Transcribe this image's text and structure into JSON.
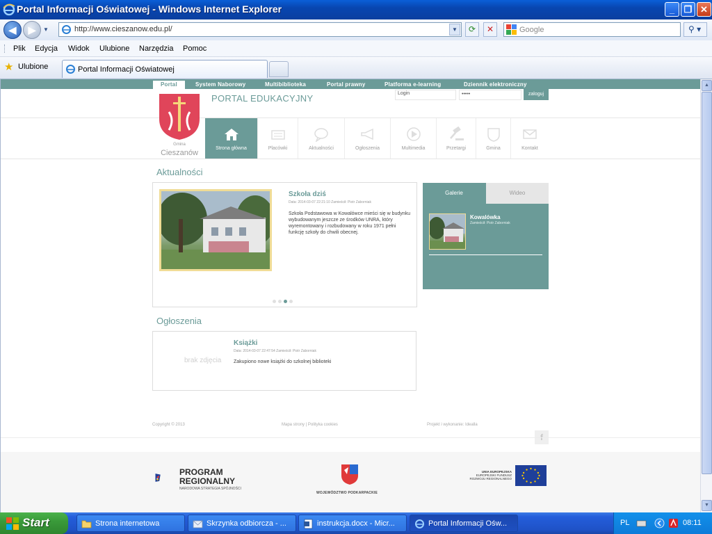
{
  "window": {
    "title": "Portal Informacji Oświatowej - Windows Internet Explorer"
  },
  "browser": {
    "url": "http://www.cieszanow.edu.pl/",
    "search_placeholder": "Google",
    "menu": [
      "Plik",
      "Edycja",
      "Widok",
      "Ulubione",
      "Narzędzia",
      "Pomoc"
    ],
    "favorites_label": "Ulubione",
    "tab_title": "Portal Informacji Oświatowej"
  },
  "site": {
    "top_links": [
      "Portal",
      "System Naborowy",
      "Multibiblioteka",
      "Portal prawny",
      "Platforma e-learning",
      "Dziennik elektroniczny"
    ],
    "gmina_small": "Gmina",
    "gmina_name": "Cieszanów",
    "portal_title": "PORTAL EDUKACYJNY",
    "login_placeholder": "Login",
    "password_mask": "•••••",
    "login_button": "zaloguj",
    "nav": [
      "Strona główna",
      "Placówki",
      "Aktualności",
      "Ogłoszenia",
      "Multimedia",
      "Przetargi",
      "Gmina",
      "Kontakt"
    ],
    "news": {
      "section_title": "Aktualności",
      "title": "Szkoła dziś",
      "meta": "Data: 2014-03-07 22:21:10 Zamieścił: Piotr Zaborniak",
      "text": "Szkoła Podstawowa w Kowalówce mieści się w budynku wybudowanym jeszcze ze środków UNRA, który wyremontowany i rozbudowany w roku 1971 pełni funkcję szkoły do chwili obecnej."
    },
    "gallery": {
      "tab1": "Galerie",
      "tab2": "Wideo",
      "item_title": "Kowalówka",
      "item_meta": "Zamieścił: Piotr Zaborniak"
    },
    "notices": {
      "section_title": "Ogłoszenia",
      "no_photo": "brak zdjęcia",
      "title": "Książki",
      "meta": "Data: 2014-03-07 22:47:54 Zamieścił: Piotr Zaborniak",
      "text": "Zakupiono nowe książki do szkolnej biblioteki"
    },
    "footer": {
      "copyright": "Copyright © 2013",
      "sitemap": "Mapa strony | Polityka cookies",
      "project": "Projekt i wykonanie: Idealla",
      "facebook": "f"
    },
    "logos": {
      "program1": "PROGRAM",
      "program2": "REGIONALNY",
      "program3": "NARODOWA STRATEGIA SPÓJNOŚCI",
      "wojewodztwo": "WOJEWÓDZTWO PODKARPACKIE",
      "ue1": "UNIA EUROPEJSKA",
      "ue2": "EUROPEJSKI FUNDUSZ",
      "ue3": "ROZWOJU REGIONALNEGO"
    }
  },
  "taskbar": {
    "start": "Start",
    "items": [
      "Strona internetowa",
      "Skrzynka odbiorcza - ...",
      "instrukcja.docx - Micr...",
      "Portal Informacji Ośw..."
    ],
    "lang": "PL",
    "time": "08:11"
  },
  "colors": {
    "accent": "#6b9b98",
    "xp_blue": "#245edb",
    "start_green": "#3a9a3a"
  }
}
